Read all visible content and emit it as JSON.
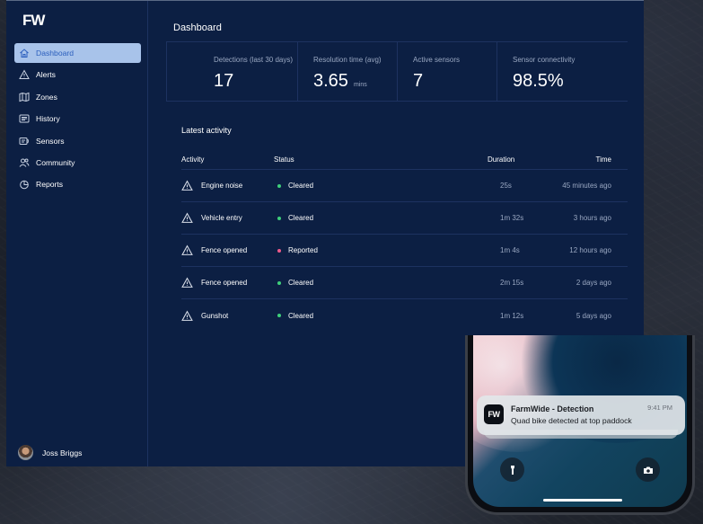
{
  "app": {
    "logo": "FW"
  },
  "sidebar": {
    "items": [
      {
        "label": "Dashboard",
        "icon": "home-icon",
        "active": true
      },
      {
        "label": "Alerts",
        "icon": "warning-icon"
      },
      {
        "label": "Zones",
        "icon": "map-icon"
      },
      {
        "label": "History",
        "icon": "history-icon"
      },
      {
        "label": "Sensors",
        "icon": "sensor-icon"
      },
      {
        "label": "Community",
        "icon": "community-icon"
      },
      {
        "label": "Reports",
        "icon": "reports-icon"
      }
    ],
    "user": {
      "name": "Joss Briggs"
    }
  },
  "main": {
    "title": "Dashboard",
    "stats": [
      {
        "label": "Detections (last 30 days)",
        "value": "17",
        "unit": ""
      },
      {
        "label": "Resolution time (avg)",
        "value": "3.65",
        "unit": "mins"
      },
      {
        "label": "Active sensors",
        "value": "7",
        "unit": ""
      },
      {
        "label": "Sensor connectivity",
        "value": "98.5%",
        "unit": ""
      }
    ],
    "activity": {
      "title": "Latest activity",
      "columns": [
        "Activity",
        "Status",
        "Duration",
        "Time"
      ],
      "rows": [
        {
          "activity": "Engine noise",
          "status": "Cleared",
          "duration": "25s",
          "time": "45 minutes ago"
        },
        {
          "activity": "Vehicle entry",
          "status": "Cleared",
          "duration": "1m 32s",
          "time": "3 hours ago"
        },
        {
          "activity": "Fence opened",
          "status": "Reported",
          "duration": "1m 4s",
          "time": "12 hours ago"
        },
        {
          "activity": "Fence opened",
          "status": "Cleared",
          "duration": "2m 15s",
          "time": "2 days ago"
        },
        {
          "activity": "Gunshot",
          "status": "Cleared",
          "duration": "1m 12s",
          "time": "5 days ago"
        }
      ]
    }
  },
  "colors": {
    "cleared": "#3ecf7a",
    "reported": "#ef5b8a",
    "accent": "#a8c3ea",
    "background": "#0c1f43"
  },
  "phone": {
    "notification": {
      "app_icon": "FW",
      "title": "FarmWide - Detection",
      "body": "Quad bike detected at top paddock",
      "time": "9:41 PM"
    }
  }
}
